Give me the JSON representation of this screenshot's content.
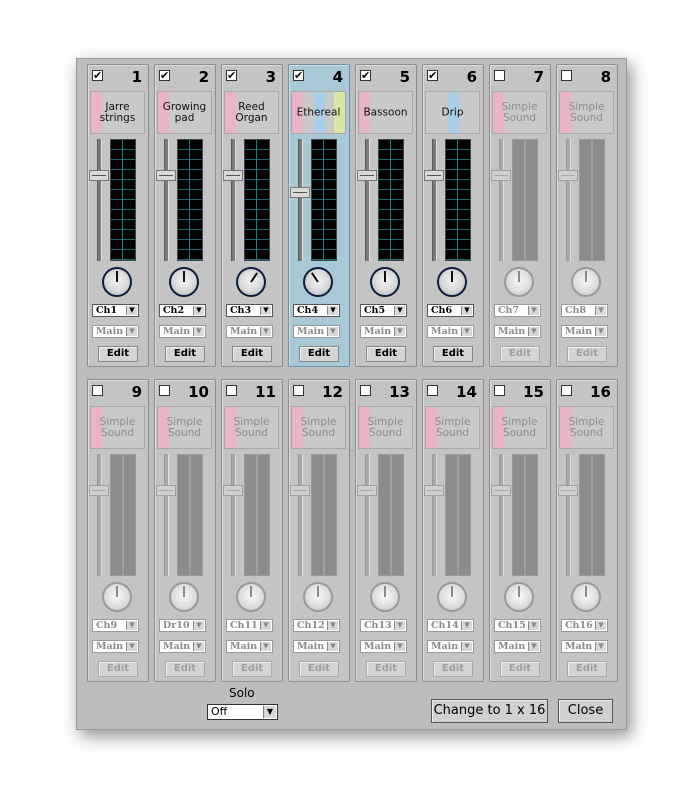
{
  "colors": {
    "window_bg": "#bdbdbd",
    "selected_strip": "#a8c8d6",
    "sound_pink": "#e8b4c6",
    "sound_blue": "#a9cfe6",
    "sound_green": "#d8e6a6",
    "meter_grid": "#1f7e8a"
  },
  "strips": [
    {
      "num": "1",
      "checked": true,
      "name": "Jarre strings",
      "channel": "Ch1",
      "output": "Main",
      "edit": "Edit",
      "active": true,
      "selected": false,
      "fader_level": 0.72,
      "pan": 0.0,
      "colors": [
        "#e8b4c6"
      ]
    },
    {
      "num": "2",
      "checked": true,
      "name": "Growing pad",
      "channel": "Ch2",
      "output": "Main",
      "edit": "Edit",
      "active": true,
      "selected": false,
      "fader_level": 0.72,
      "pan": 0.0,
      "colors": [
        "#e8b4c6"
      ]
    },
    {
      "num": "3",
      "checked": true,
      "name": "Reed Organ",
      "channel": "Ch3",
      "output": "Main",
      "edit": "Edit",
      "active": true,
      "selected": false,
      "fader_level": 0.72,
      "pan": 0.25,
      "colors": [
        "#e8b4c6"
      ]
    },
    {
      "num": "4",
      "checked": true,
      "name": "Ethereal",
      "channel": "Ch4",
      "output": "Main",
      "edit": "Edit",
      "active": true,
      "selected": true,
      "fader_level": 0.57,
      "pan": -0.25,
      "colors": [
        "#e8b4c6",
        "#a9cfe6",
        "#d8e6a6"
      ]
    },
    {
      "num": "5",
      "checked": true,
      "name": "Bassoon",
      "channel": "Ch5",
      "output": "Main",
      "edit": "Edit",
      "active": true,
      "selected": false,
      "fader_level": 0.72,
      "pan": 0.0,
      "colors": [
        "#e8b4c6"
      ]
    },
    {
      "num": "6",
      "checked": true,
      "name": "Drip",
      "channel": "Ch6",
      "output": "Main",
      "edit": "Edit",
      "active": true,
      "selected": false,
      "fader_level": 0.72,
      "pan": 0.0,
      "colors": [
        "#a9cfe6"
      ]
    },
    {
      "num": "7",
      "checked": false,
      "name": "Simple Sound",
      "channel": "Ch7",
      "output": "Main",
      "edit": "Edit",
      "active": false,
      "selected": false,
      "fader_level": 0.72,
      "pan": 0.0,
      "colors": [
        "#e8b4c6"
      ]
    },
    {
      "num": "8",
      "checked": false,
      "name": "Simple Sound",
      "channel": "Ch8",
      "output": "Main",
      "edit": "Edit",
      "active": false,
      "selected": false,
      "fader_level": 0.72,
      "pan": 0.0,
      "colors": [
        "#e8b4c6"
      ]
    },
    {
      "num": "9",
      "checked": false,
      "name": "Simple Sound",
      "channel": "Ch9",
      "output": "Main",
      "edit": "Edit",
      "active": false,
      "selected": false,
      "fader_level": 0.72,
      "pan": 0.0,
      "colors": [
        "#e8b4c6"
      ]
    },
    {
      "num": "10",
      "checked": false,
      "name": "Simple Sound",
      "channel": "Dr10",
      "output": "Main",
      "edit": "Edit",
      "active": false,
      "selected": false,
      "fader_level": 0.72,
      "pan": 0.0,
      "colors": [
        "#e8b4c6"
      ]
    },
    {
      "num": "11",
      "checked": false,
      "name": "Simple Sound",
      "channel": "Ch11",
      "output": "Main",
      "edit": "Edit",
      "active": false,
      "selected": false,
      "fader_level": 0.72,
      "pan": 0.0,
      "colors": [
        "#e8b4c6"
      ]
    },
    {
      "num": "12",
      "checked": false,
      "name": "Simple Sound",
      "channel": "Ch12",
      "output": "Main",
      "edit": "Edit",
      "active": false,
      "selected": false,
      "fader_level": 0.72,
      "pan": 0.0,
      "colors": [
        "#e8b4c6"
      ]
    },
    {
      "num": "13",
      "checked": false,
      "name": "Simple Sound",
      "channel": "Ch13",
      "output": "Main",
      "edit": "Edit",
      "active": false,
      "selected": false,
      "fader_level": 0.72,
      "pan": 0.0,
      "colors": [
        "#e8b4c6"
      ]
    },
    {
      "num": "14",
      "checked": false,
      "name": "Simple Sound",
      "channel": "Ch14",
      "output": "Main",
      "edit": "Edit",
      "active": false,
      "selected": false,
      "fader_level": 0.72,
      "pan": 0.0,
      "colors": [
        "#e8b4c6"
      ]
    },
    {
      "num": "15",
      "checked": false,
      "name": "Simple Sound",
      "channel": "Ch15",
      "output": "Main",
      "edit": "Edit",
      "active": false,
      "selected": false,
      "fader_level": 0.72,
      "pan": 0.0,
      "colors": [
        "#e8b4c6"
      ]
    },
    {
      "num": "16",
      "checked": false,
      "name": "Simple Sound",
      "channel": "Ch16",
      "output": "Main",
      "edit": "Edit",
      "active": false,
      "selected": false,
      "fader_level": 0.72,
      "pan": 0.0,
      "colors": [
        "#e8b4c6"
      ]
    }
  ],
  "footer": {
    "solo_label": "Solo",
    "solo_value": "Off",
    "change_layout_label": "Change to 1 x 16",
    "close_label": "Close"
  }
}
